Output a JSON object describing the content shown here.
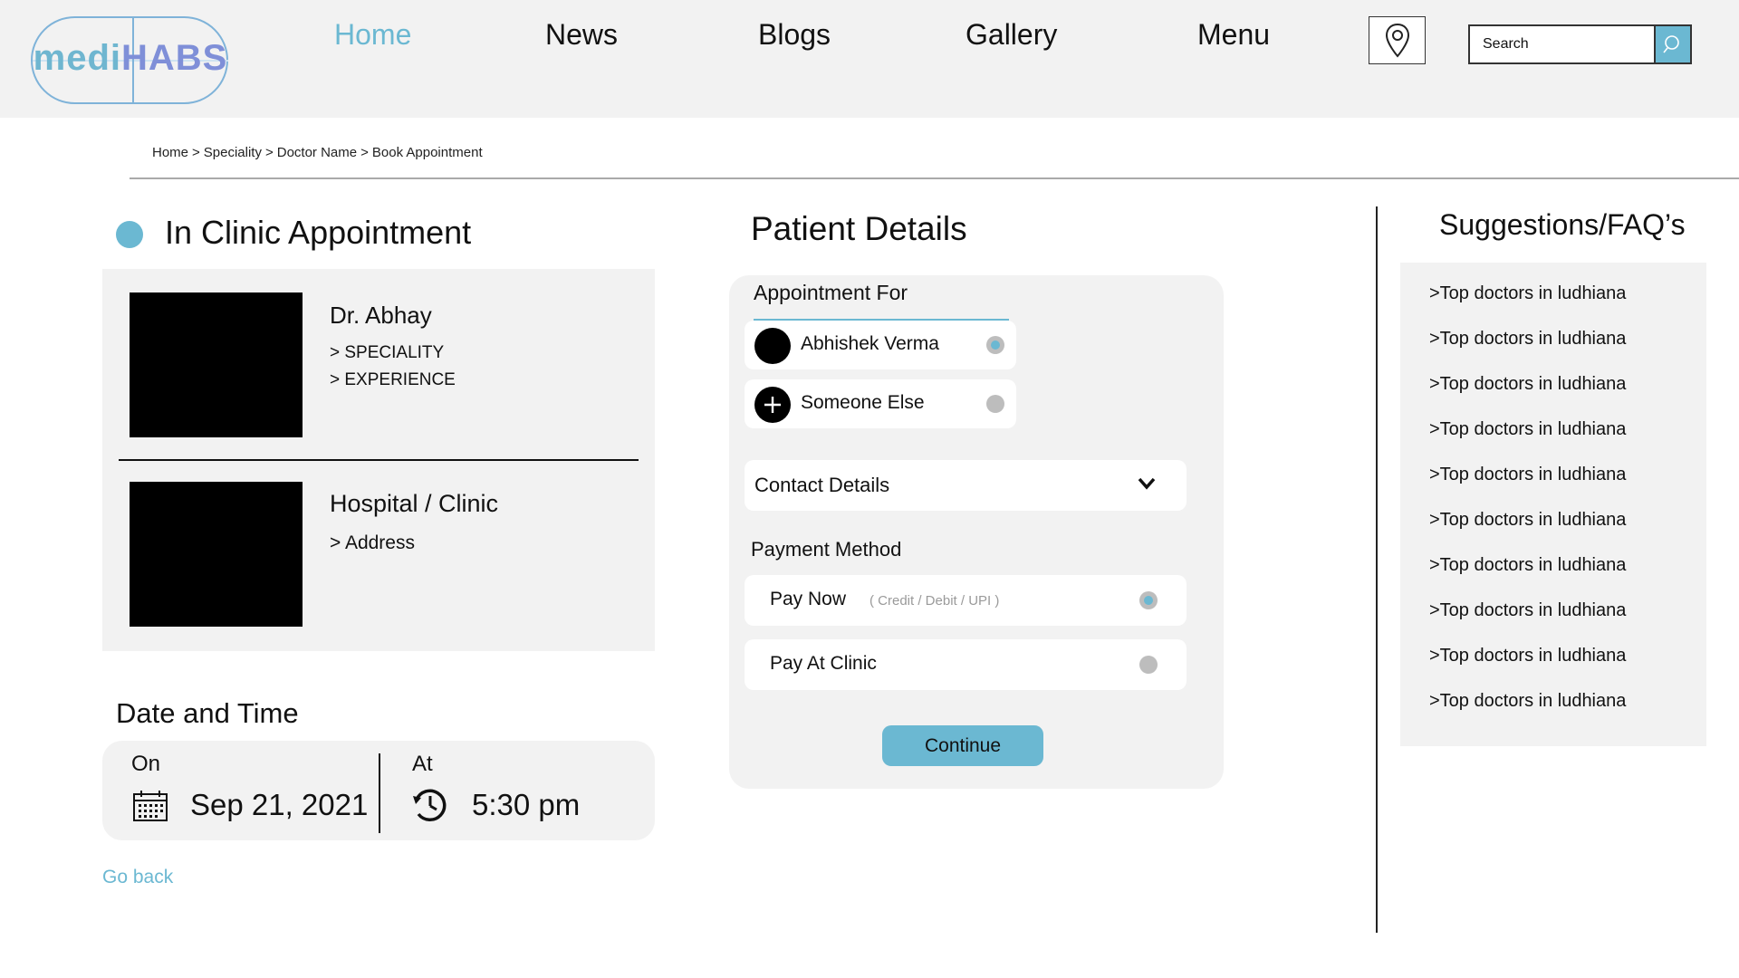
{
  "header": {
    "logo": {
      "part1": "medi",
      "part2": "HABS"
    },
    "nav": [
      {
        "label": "Home",
        "active": true
      },
      {
        "label": "News",
        "active": false
      },
      {
        "label": "Blogs",
        "active": false
      },
      {
        "label": "Gallery",
        "active": false
      },
      {
        "label": "Menu",
        "active": false
      }
    ],
    "location_icon": "location-pin-icon",
    "search": {
      "placeholder": "Search",
      "icon": "search-icon"
    }
  },
  "breadcrumb": [
    "Home",
    "Speciality",
    "Doctor Name",
    "Book Appointment"
  ],
  "breadcrumb_separator": ">",
  "appointment": {
    "title": "In Clinic Appointment",
    "doctor": {
      "name": "Dr. Abhay",
      "speciality": "> SPECIALITY",
      "experience": "> EXPERIENCE"
    },
    "hospital": {
      "name": "Hospital / Clinic",
      "address": "> Address"
    }
  },
  "date_time": {
    "title": "Date and Time",
    "on_label": "On",
    "date": "Sep 21, 2021",
    "at_label": "At",
    "time": "5:30 pm"
  },
  "go_back": "Go back",
  "patient": {
    "title": "Patient Details",
    "appointment_for_label": "Appointment For",
    "options": [
      {
        "label": "Abhishek Verma",
        "selected": true
      },
      {
        "label": "Someone Else",
        "selected": false
      }
    ],
    "contact_label": "Contact Details",
    "payment_title": "Payment Method",
    "payment_options": [
      {
        "label": "Pay Now",
        "sub": "( Credit / Debit / UPI )",
        "selected": true
      },
      {
        "label": "Pay At Clinic",
        "sub": "",
        "selected": false
      }
    ],
    "continue_label": "Continue"
  },
  "faq": {
    "title": "Suggestions/FAQ’s",
    "items": [
      ">Top doctors in ludhiana",
      ">Top doctors in ludhiana",
      ">Top doctors in ludhiana",
      ">Top doctors in ludhiana",
      ">Top doctors in ludhiana",
      ">Top doctors in ludhiana",
      ">Top doctors in ludhiana",
      ">Top doctors in ludhiana",
      ">Top doctors in ludhiana",
      ">Top doctors in ludhiana"
    ]
  },
  "colors": {
    "accent": "#6bb8d2",
    "panel": "#f2f2f2",
    "logo_border": "#7fb3d9"
  }
}
